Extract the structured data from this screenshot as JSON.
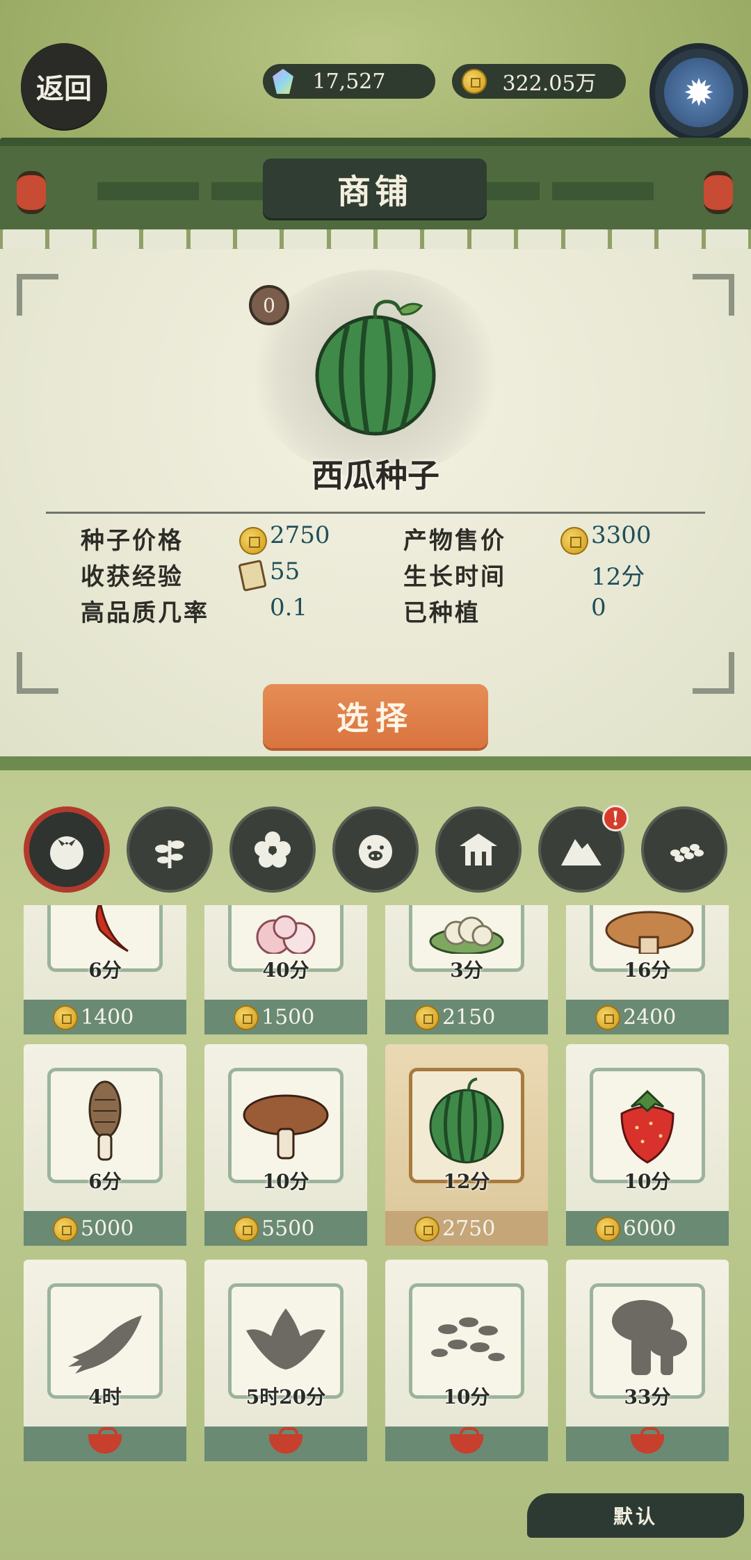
{
  "header": {
    "back_label": "返回",
    "gems": "17,527",
    "coins": "322.05万",
    "title": "商铺"
  },
  "detail": {
    "owned_count": "0",
    "name": "西瓜种子",
    "stats": {
      "seed_price_label": "种子价格",
      "seed_price": "2750",
      "sell_price_label": "产物售价",
      "sell_price": "3300",
      "exp_label": "收获经验",
      "exp": "55",
      "grow_time_label": "生长时间",
      "grow_time": "12分",
      "quality_label": "高品质几率",
      "quality": "0.1",
      "planted_label": "已种植",
      "planted": "0"
    },
    "select_label": "选择"
  },
  "categories": [
    {
      "icon": "tomato-icon",
      "active": true
    },
    {
      "icon": "sprout-icon",
      "active": false
    },
    {
      "icon": "flower-icon",
      "active": false
    },
    {
      "icon": "pig-icon",
      "active": false
    },
    {
      "icon": "house-icon",
      "active": false
    },
    {
      "icon": "mountain-icon",
      "active": false,
      "alert": "!"
    },
    {
      "icon": "grain-icon",
      "active": false
    }
  ],
  "items": [
    {
      "name": "chili",
      "time": "6分",
      "price": "1400",
      "locked": false
    },
    {
      "name": "peony",
      "time": "40分",
      "price": "1500",
      "locked": false
    },
    {
      "name": "cauliflower",
      "time": "3分",
      "price": "2150",
      "locked": false
    },
    {
      "name": "mushroom-brown",
      "time": "16分",
      "price": "2400",
      "locked": false
    },
    {
      "name": "morel",
      "time": "6分",
      "price": "5000",
      "locked": false
    },
    {
      "name": "shiitake",
      "time": "10分",
      "price": "5500",
      "locked": false
    },
    {
      "name": "watermelon",
      "time": "12分",
      "price": "2750",
      "locked": false,
      "selected": true
    },
    {
      "name": "strawberry",
      "time": "10分",
      "price": "6000",
      "locked": false
    },
    {
      "name": "ginseng",
      "time": "4时",
      "price": "",
      "locked": true
    },
    {
      "name": "lotus",
      "time": "5时20分",
      "price": "",
      "locked": true
    },
    {
      "name": "sunflower-seeds",
      "time": "10分",
      "price": "",
      "locked": true
    },
    {
      "name": "mushroom-cluster",
      "time": "33分",
      "price": "",
      "locked": true
    }
  ],
  "sort_label": "默认",
  "colors": {
    "accent_orange": "#d9743f",
    "dark_plate": "#2f3d33",
    "value_teal": "#1f4e59",
    "lock_red": "#c6402d"
  }
}
